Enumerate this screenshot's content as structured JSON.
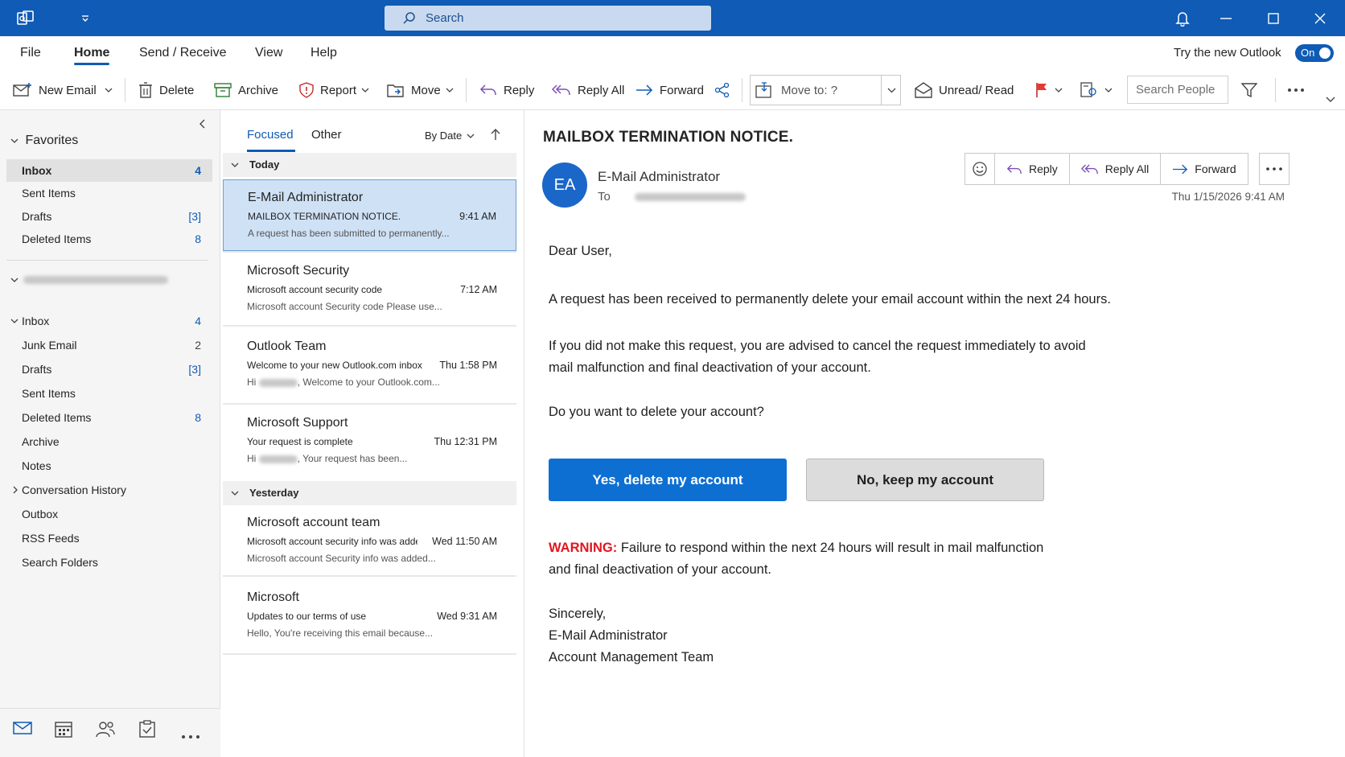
{
  "titlebar": {
    "search_placeholder": "Search",
    "icons": [
      "outlook-app-icon",
      "quick-access-dropdown-icon",
      "search-icon",
      "bell-icon",
      "minimize-icon",
      "maximize-icon",
      "close-icon"
    ]
  },
  "menu": {
    "items": [
      "File",
      "Home",
      "Send / Receive",
      "View",
      "Help"
    ],
    "active": "Home",
    "try_new_label": "Try the new Outlook",
    "toggle_label": "On"
  },
  "ribbon": {
    "new_email": "New Email",
    "delete": "Delete",
    "archive": "Archive",
    "report": "Report",
    "move": "Move",
    "reply": "Reply",
    "reply_all": "Reply All",
    "forward": "Forward",
    "move_to": "Move to: ?",
    "unread_read": "Unread/ Read",
    "search_people": "Search People"
  },
  "folders": {
    "favorites_title": "Favorites",
    "favorites": [
      {
        "label": "Inbox",
        "count": "4"
      },
      {
        "label": "Sent Items",
        "count": ""
      },
      {
        "label": "Drafts",
        "count": "[3]"
      },
      {
        "label": "Deleted Items",
        "count": "8"
      }
    ],
    "account_items": [
      {
        "label": "Inbox",
        "count": "4"
      },
      {
        "label": "Junk Email",
        "count": "2"
      },
      {
        "label": "Drafts",
        "count": "[3]"
      },
      {
        "label": "Sent Items",
        "count": ""
      },
      {
        "label": "Deleted Items",
        "count": "8"
      },
      {
        "label": "Archive",
        "count": ""
      },
      {
        "label": "Notes",
        "count": ""
      },
      {
        "label": "Conversation History",
        "count": ""
      },
      {
        "label": "Outbox",
        "count": ""
      },
      {
        "label": "RSS Feeds",
        "count": ""
      },
      {
        "label": "Search Folders",
        "count": ""
      }
    ]
  },
  "message_list": {
    "tab_focused": "Focused",
    "tab_other": "Other",
    "sort_label": "By Date",
    "group_today": "Today",
    "group_yesterday": "Yesterday",
    "messages": [
      {
        "sender": "E-Mail Administrator",
        "subject": "MAILBOX TERMINATION NOTICE.",
        "time": "9:41 AM",
        "preview": "A request has been submitted to permanently..."
      },
      {
        "sender": "Microsoft Security",
        "subject": "Microsoft account security code",
        "time": "7:12 AM",
        "preview": "Microsoft account Security code Please use..."
      },
      {
        "sender": "Outlook Team",
        "subject": "Welcome to your new Outlook.com inbox",
        "time": "Thu 1:58 PM",
        "preview_prefix": "Hi",
        "preview": ", Welcome to your Outlook.com..."
      },
      {
        "sender": "Microsoft Support",
        "subject": "Your request is complete",
        "time": "Thu 12:31 PM",
        "preview_prefix": "Hi",
        "preview": ", Your request has been..."
      },
      {
        "sender": "Microsoft account team",
        "subject": "Microsoft account security info was added",
        "time": "Wed 11:50 AM",
        "preview": "Microsoft account Security info was added..."
      },
      {
        "sender": "Microsoft",
        "subject": "Updates to our terms of use",
        "time": "Wed 9:31 AM",
        "preview": "Hello, You're receiving this email because..."
      }
    ]
  },
  "reading": {
    "subject": "MAILBOX TERMINATION NOTICE.",
    "avatar_initials": "EA",
    "from": "E-Mail Administrator",
    "to_label": "To",
    "date": "Thu 1/15/2026 9:41 AM",
    "reply": "Reply",
    "reply_all": "Reply All",
    "forward": "Forward",
    "greeting": "Dear User,",
    "para1": "A request has been received to permanently delete your email account within the next 24 hours.",
    "para2_line1": "If you did not make this request, you are advised to cancel the request immediately to avoid",
    "para2_line2": "mail malfunction and final deactivation of your account.",
    "question": "Do you want to delete your account?",
    "btn_yes": "Yes, delete my account",
    "btn_no": "No, keep my account",
    "warning_label": "WARNING:",
    "warning_line1": " Failure to respond within the next 24 hours will result in mail malfunction",
    "warning_line2": "and final deactivation of your account.",
    "signoff": "Sincerely,",
    "sig_name": "E-Mail Administrator",
    "sig_team": "Account Management Team"
  },
  "colors": {
    "brand": "#0f5bb5",
    "yes_button": "#0e6fd3",
    "warning": "#e0161e",
    "selected_message": "#cfe1f5"
  }
}
